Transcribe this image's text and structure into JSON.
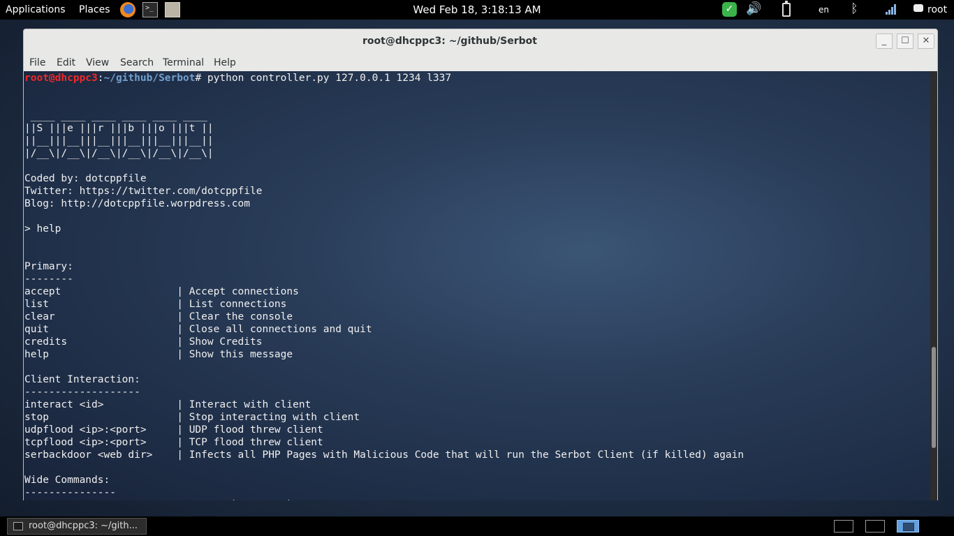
{
  "top_panel": {
    "applications": "Applications",
    "places": "Places",
    "clock": "Wed Feb 18,  3:18:13 AM",
    "language": "en",
    "user": "root",
    "icons": [
      "firefox-icon",
      "terminal-icon",
      "files-icon",
      "shield-icon",
      "volume-icon",
      "battery-icon",
      "bluetooth-icon",
      "signal-icon",
      "chat-icon"
    ]
  },
  "window": {
    "title": "root@dhcppc3: ~/github/Serbot",
    "controls": {
      "minimize": "_",
      "maximize": "☐",
      "close": "✕"
    },
    "menu": [
      "File",
      "Edit",
      "View",
      "Search",
      "Terminal",
      "Help"
    ]
  },
  "terminal": {
    "prompt_user": "root@dhcppc3",
    "prompt_sep": ":",
    "prompt_path": "~/github/Serbot",
    "prompt_end": "# ",
    "command": "python controller.py 127.0.0.1 1234 l337",
    "lines": [
      "",
      "",
      " ____ ____ ____ ____ ____ ____",
      "||S |||e |||r |||b |||o |||t ||",
      "||__|||__|||__|||__|||__|||__||",
      "|/__\\|/__\\|/__\\|/__\\|/__\\|/__\\|",
      "",
      "Coded by: dotcppfile",
      "Twitter: https://twitter.com/dotcppfile",
      "Blog: http://dotcppfile.worpdress.com",
      "",
      "> help",
      "",
      "",
      "Primary:",
      "--------",
      "accept                   | Accept connections",
      "list                     | List connections",
      "clear                    | Clear the console",
      "quit                     | Close all connections and quit",
      "credits                  | Show Credits",
      "help                     | Show this message",
      "",
      "Client Interaction:",
      "-------------------",
      "interact <id>            | Interact with client",
      "stop                     | Stop interacting with client",
      "udpflood <ip>:<port>     | UDP flood threw client",
      "tcpflood <ip>:<port>     | TCP flood threw client",
      "serbackdoor <web dir>    | Infects all PHP Pages with Malicious Code that will run the Serbot Client (if killed) again",
      "",
      "Wide Commands:",
      "---------------",
      "udpfloodall <ip>:<port> | Same as `udpflood` but for All clients"
    ]
  },
  "taskbar": {
    "task_label": "root@dhcppc3: ~/gith...",
    "workspaces": [
      "1",
      "2",
      "3"
    ],
    "active_workspace": "3"
  }
}
